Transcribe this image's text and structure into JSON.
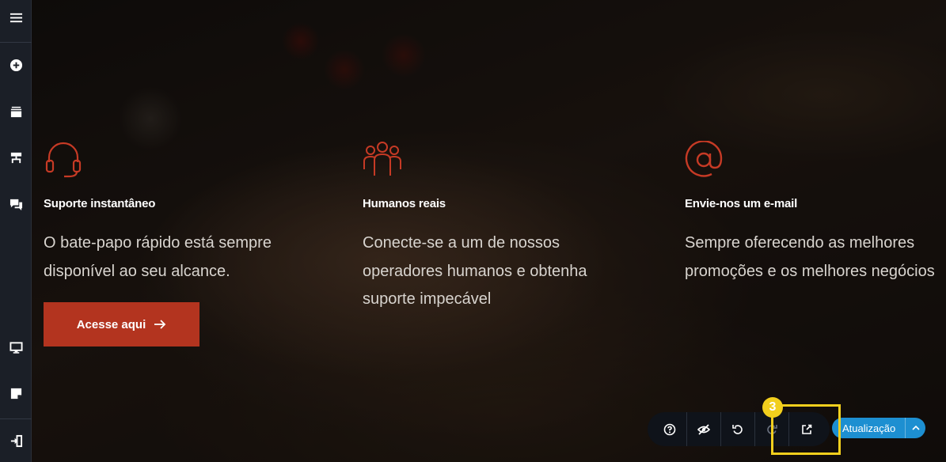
{
  "sidebar": {
    "items": [
      {
        "name": "menu",
        "icon": "hamburger-icon"
      },
      {
        "name": "add",
        "icon": "plus-circle-icon"
      },
      {
        "name": "layers",
        "icon": "layers-icon"
      },
      {
        "name": "navigator",
        "icon": "navigator-icon"
      },
      {
        "name": "comments",
        "icon": "chat-icon"
      },
      {
        "name": "responsive",
        "icon": "desktop-icon"
      },
      {
        "name": "notes",
        "icon": "note-icon"
      },
      {
        "name": "exit",
        "icon": "exit-icon"
      }
    ]
  },
  "features": [
    {
      "icon": "headset-icon",
      "title": "Suporte instantâneo",
      "lines": [
        "O bate-papo rápido está sempre",
        "disponível ao seu alcance."
      ]
    },
    {
      "icon": "people-icon",
      "title": "Humanos reais",
      "lines": [
        "Conecte-se a um de nossos",
        "operadores humanos e obtenha",
        "suporte impecável"
      ]
    },
    {
      "icon": "at-sign-icon",
      "title": "Envie-nos um e-mail",
      "lines": [
        "Sempre oferecendo as melhores",
        "promoções e os melhores negócios"
      ]
    }
  ],
  "cta": {
    "label": "Acesse aqui",
    "icon": "arrow-right-icon"
  },
  "toolbar": {
    "buttons": [
      "help-icon",
      "hide-icon",
      "undo-icon",
      "redo-icon",
      "external-link-icon"
    ],
    "update_label": "Atualização"
  },
  "tutorial": {
    "step": "3",
    "highlight_color": "#f2cf1d"
  },
  "colors": {
    "accent": "#b3341f",
    "update": "#1d8fd1",
    "icon_red": "#c63a25"
  }
}
